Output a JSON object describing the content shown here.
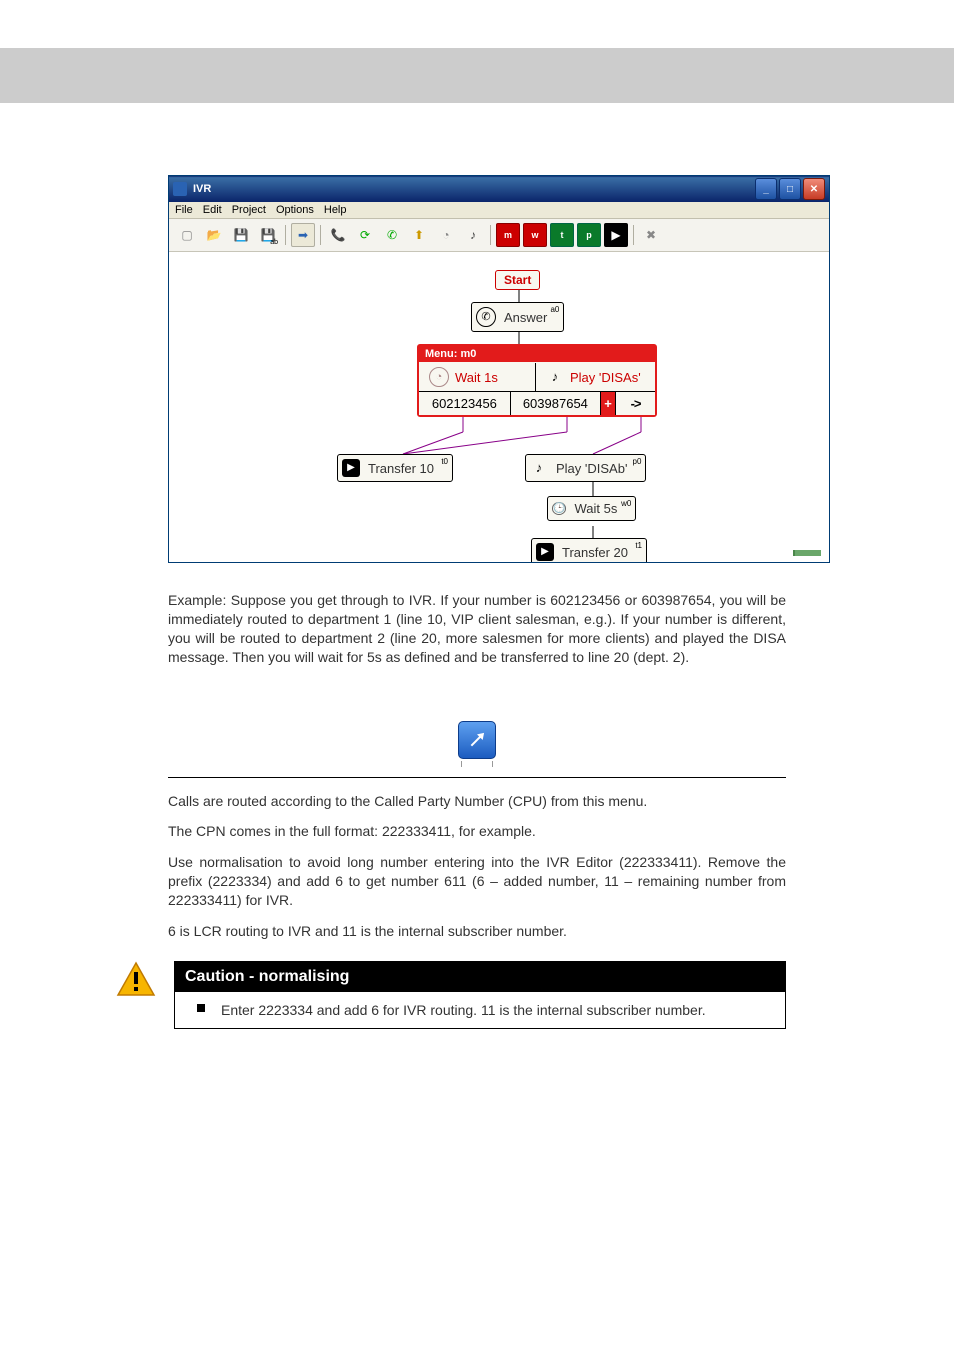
{
  "header": {},
  "app": {
    "title": "IVR",
    "menubar": [
      "File",
      "Edit",
      "Project",
      "Options",
      "Help"
    ],
    "toolbar_icon_names": [
      "new",
      "open",
      "save",
      "saveas",
      "sep",
      "goto",
      "sep",
      "ring",
      "redial",
      "answer",
      "hangup",
      "wait",
      "play",
      "sep",
      "menu-m",
      "menu-w",
      "menu-t",
      "menu-p",
      "transfer",
      "sep",
      "close"
    ]
  },
  "diagram": {
    "start": "Start",
    "answer": {
      "label": "Answer",
      "tag": "a0"
    },
    "menu": {
      "title": "Menu: m0",
      "row1": {
        "wait": "Wait 1s",
        "play": "Play 'DISAs'"
      },
      "row2": {
        "num1": "602123456",
        "num2": "603987654",
        "plus": "+",
        "arrow": "->"
      }
    },
    "transfer10": {
      "label": "Transfer 10",
      "tag": "t0"
    },
    "playDisab": {
      "label": "Play 'DISAb'",
      "tag": "p0"
    },
    "wait5": {
      "label": "Wait 5s",
      "tag": "w0"
    },
    "transfer20": {
      "label": "Transfer 20",
      "tag": "t1"
    }
  },
  "example_paragraph": "Example: Suppose you get through to IVR. If your number is 602123456 or 603987654, you will be immediately routed to department 1 (line 10, VIP client salesman, e.g.). If your number is different, you will be routed to department 2 (line 20, more salesmen for more clients) and played the DISA message. Then you will wait for 5s  as defined and be transferred to line 20 (dept. 2).",
  "section2": {
    "p1": "Calls are routed according to the Called Party Number (CPU) from this menu.",
    "p2": "The CPN comes in the full format: 222333411, for example.",
    "p3": "Use normalisation to avoid long number entering into the IVR Editor (222333411). Remove the prefix (2223334) and add 6 to get number 611 (6 – added number, 11 – remaining number from 222333411) for IVR.",
    "p4": "6 is LCR routing to IVR and 11 is the internal subscriber number."
  },
  "callout": {
    "title": "Caution - normalising",
    "body": "Enter 2223334 and add 6 for IVR routing. 11 is the internal subscriber number."
  }
}
